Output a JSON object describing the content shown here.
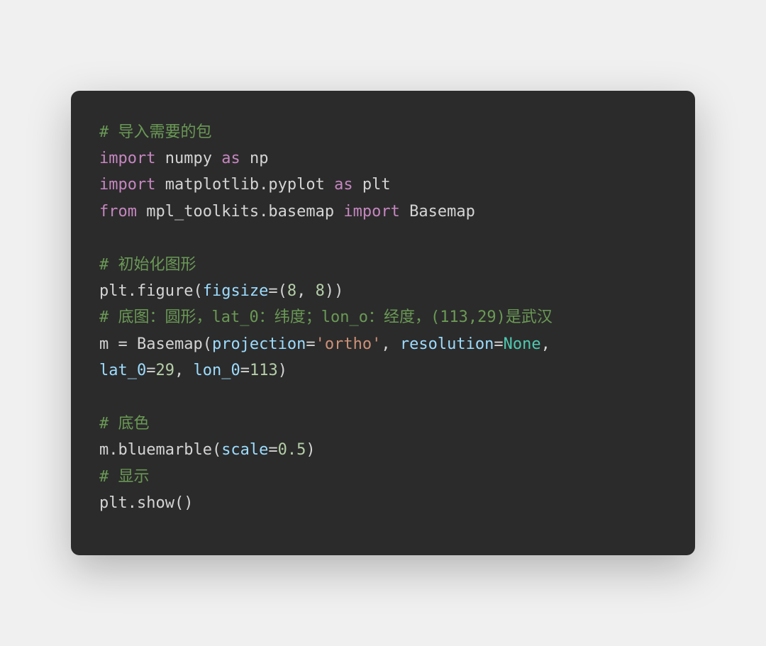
{
  "code": {
    "line1_comment": "# 导入需要的包",
    "line2_kw1": "import",
    "line2_mod": " numpy ",
    "line2_kw2": "as",
    "line2_alias": " np",
    "line3_kw1": "import",
    "line3_mod": " matplotlib.pyplot ",
    "line3_kw2": "as",
    "line3_alias": " plt",
    "line4_kw1": "from",
    "line4_mod": " mpl_toolkits.basemap ",
    "line4_kw2": "import",
    "line4_cls": " Basemap",
    "line6_comment": "# 初始化图形",
    "line7_pre": "plt.figure(",
    "line7_arg": "figsize",
    "line7_eq": "=(",
    "line7_n1": "8",
    "line7_c": ", ",
    "line7_n2": "8",
    "line7_post": "))",
    "line8_comment": "# 底图：圆形，lat_0：纬度；lon_o：经度，(113,29)是武汉",
    "line9_pre": "m = Basemap(",
    "line9_arg1": "projection",
    "line9_eq1": "=",
    "line9_str": "'ortho'",
    "line9_c1": ", ",
    "line9_arg2": "resolution",
    "line9_eq2": "=",
    "line9_none": "None",
    "line9_c2": ", ",
    "line10_arg1": "lat_0",
    "line10_eq1": "=",
    "line10_n1": "29",
    "line10_c": ", ",
    "line10_arg2": "lon_0",
    "line10_eq2": "=",
    "line10_n2": "113",
    "line10_post": ")",
    "line12_comment": "# 底色",
    "line13_pre": "m.bluemarble(",
    "line13_arg": "scale",
    "line13_eq": "=",
    "line13_n": "0.5",
    "line13_post": ")",
    "line14_comment": "# 显示",
    "line15": "plt.show()"
  }
}
